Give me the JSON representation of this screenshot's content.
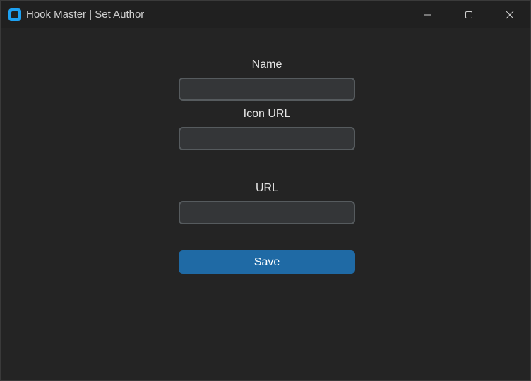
{
  "window": {
    "title": "Hook Master | Set Author",
    "controls": {
      "minimize_icon": "minimize-icon",
      "maximize_icon": "maximize-icon",
      "close_icon": "close-icon"
    }
  },
  "form": {
    "name_label": "Name",
    "name_value": "",
    "icon_url_label": "Icon URL",
    "icon_url_value": "",
    "url_label": "URL",
    "url_value": "",
    "save_label": "Save"
  },
  "colors": {
    "accent": "#1f6aa5",
    "background": "#242424",
    "input_bg": "#343638",
    "input_border": "#565b5e"
  }
}
